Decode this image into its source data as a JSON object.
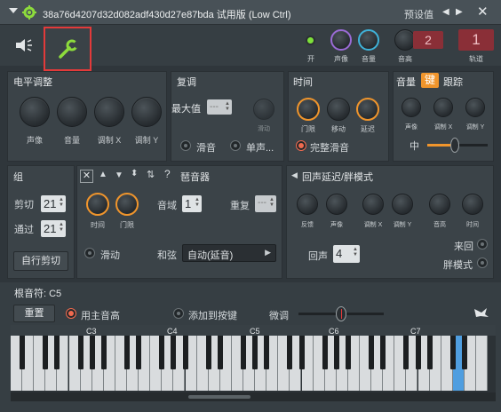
{
  "titlebar": {
    "title": "38a76d4207d32d082adf430d27e87bda 试用版 (Low Ctrl)",
    "presets": "预设值"
  },
  "toolbar": {
    "knob_labels": [
      "开",
      "声像",
      "音量",
      "音高",
      "轨道"
    ],
    "pitch_range_value": "2",
    "track_value": "1"
  },
  "level": {
    "title": "电平调整",
    "knob_labels": [
      "声像",
      "音量",
      "调制 X",
      "调制 Y"
    ]
  },
  "polyphony": {
    "title": "复调",
    "max_label": "最大值",
    "slide_knob_label": "滑动",
    "radio_glide": "滑音",
    "radio_mono": "单声..."
  },
  "time": {
    "title": "时间",
    "knob_labels": [
      "门限",
      "移动",
      "延迟"
    ],
    "radio_full_glide": "完整滑音"
  },
  "tracking": {
    "tab_volume": "音量",
    "tab_key": "键",
    "tab_track": "跟踪",
    "knob_labels": [
      "声像",
      "调制 X",
      "调制 Y"
    ],
    "mid_label": "中"
  },
  "group": {
    "title": "组",
    "cut_label": "剪切",
    "cut_value": "21",
    "pass_label": "通过",
    "pass_value": "21",
    "auto_cut_button": "自行剪切"
  },
  "arp": {
    "title": "琶音器",
    "knob_labels": [
      "时间",
      "门限"
    ],
    "range_label": "音域",
    "range_value": "1",
    "repeat_label": "重复",
    "slide_label": "滑动",
    "chord_label": "和弦",
    "chord_value": "自动(延音)"
  },
  "echo": {
    "title": "回声延迟/胖模式",
    "knob_labels": [
      "反馈",
      "声像",
      "调制 X",
      "调制 Y",
      "音高",
      "时间"
    ],
    "echo_label": "回声",
    "echo_value": "4",
    "radio_pingpong": "来回",
    "radio_fat": "胖模式"
  },
  "root": {
    "title": "根音符: C5",
    "reset_button": "重置",
    "radio_use_main_pitch": "用主音高",
    "radio_add_to_key": "添加到按键",
    "fine_tune_label": "微调"
  },
  "keyboard": {
    "octave_labels": [
      "C3",
      "C4",
      "C5",
      "C6",
      "C7"
    ],
    "highlighted": "C5"
  },
  "colors": {
    "accent_orange": "#f0952c",
    "highlight_red": "#e33a3a",
    "wrench_green": "#8ddc3c",
    "key_blue": "#4f9ee0"
  }
}
